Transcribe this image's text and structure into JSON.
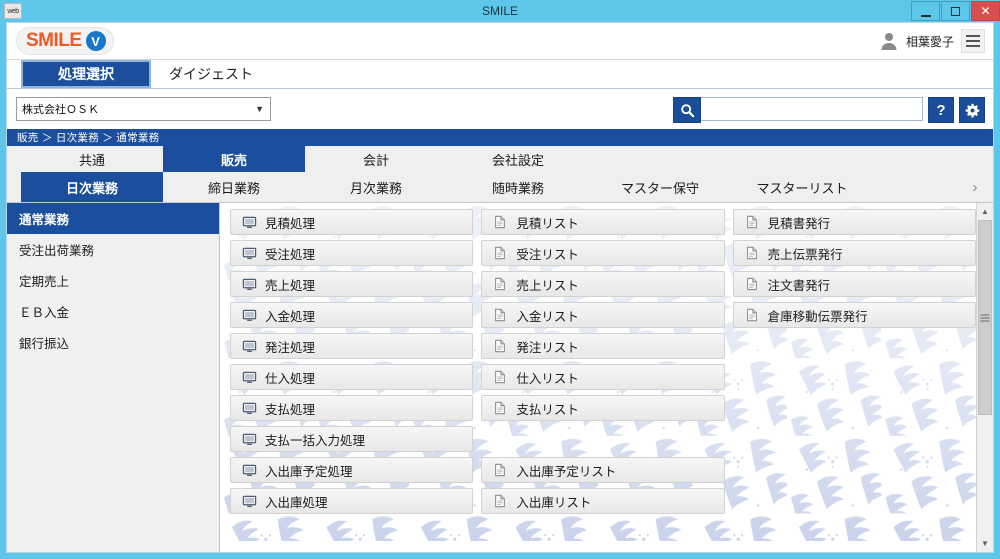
{
  "window": {
    "title": "SMILE",
    "icon_label": "web",
    "controls": {
      "minimize": "–",
      "maximize": "□",
      "close": "✕"
    }
  },
  "brand": {
    "logo_text": "SMILE",
    "logo_badge": "V",
    "user_name": "相葉愛子",
    "menu_icon": "hamburger-icon",
    "avatar_icon": "user-avatar-icon"
  },
  "top_tabs": [
    {
      "label": "処理選択",
      "active": true
    },
    {
      "label": "ダイジェスト",
      "active": false
    }
  ],
  "controls": {
    "company_value": "株式会社ＯＳＫ",
    "company_caret": "▼",
    "search_value": "",
    "search_placeholder": "",
    "search_icon": "search-icon",
    "help_label": "?",
    "settings_icon": "gear-icon"
  },
  "breadcrumb": "販売 ＞ 日次業務 ＞ 通常業務",
  "module_tabs": [
    {
      "label": "共通",
      "active": false
    },
    {
      "label": "販売",
      "active": true
    },
    {
      "label": "会計",
      "active": false
    },
    {
      "label": "会社設定",
      "active": false
    }
  ],
  "sub_tabs": [
    {
      "label": "日次業務",
      "active": true
    },
    {
      "label": "締日業務",
      "active": false
    },
    {
      "label": "月次業務",
      "active": false
    },
    {
      "label": "随時業務",
      "active": false
    },
    {
      "label": "マスター保守",
      "active": false
    },
    {
      "label": "マスターリスト",
      "active": false
    }
  ],
  "sub_tabs_more": "›",
  "sidebar": {
    "items": [
      {
        "label": "通常業務",
        "active": true
      },
      {
        "label": "受注出荷業務",
        "active": false
      },
      {
        "label": "定期売上",
        "active": false
      },
      {
        "label": "ＥＢ入金",
        "active": false
      },
      {
        "label": "銀行振込",
        "active": false
      }
    ]
  },
  "menu_columns": [
    {
      "icon": "monitor-icon",
      "items": [
        {
          "label": "見積処理"
        },
        {
          "label": "受注処理"
        },
        {
          "label": "売上処理"
        },
        {
          "label": "入金処理"
        },
        {
          "label": "発注処理"
        },
        {
          "label": "仕入処理"
        },
        {
          "label": "支払処理"
        },
        {
          "label": "支払一括入力処理"
        },
        {
          "label": "入出庫予定処理"
        },
        {
          "label": "入出庫処理"
        }
      ]
    },
    {
      "icon": "document-icon",
      "items": [
        {
          "label": "見積リスト"
        },
        {
          "label": "受注リスト"
        },
        {
          "label": "売上リスト"
        },
        {
          "label": "入金リスト"
        },
        {
          "label": "発注リスト"
        },
        {
          "label": "仕入リスト"
        },
        {
          "label": "支払リスト"
        },
        {
          "label": "",
          "spacer": true
        },
        {
          "label": "入出庫予定リスト"
        },
        {
          "label": "入出庫リスト"
        }
      ]
    },
    {
      "icon": "document-icon",
      "items": [
        {
          "label": "見積書発行"
        },
        {
          "label": "売上伝票発行"
        },
        {
          "label": "注文書発行"
        },
        {
          "label": "倉庫移動伝票発行"
        }
      ]
    }
  ],
  "scrollbar": {
    "up_arrow": "▲",
    "down_arrow": "▼"
  },
  "colors": {
    "title_bar": "#5ec6e8",
    "accent_navy": "#1b4f9e",
    "logo_orange": "#ef5a24",
    "close_red": "#d94f4f"
  }
}
